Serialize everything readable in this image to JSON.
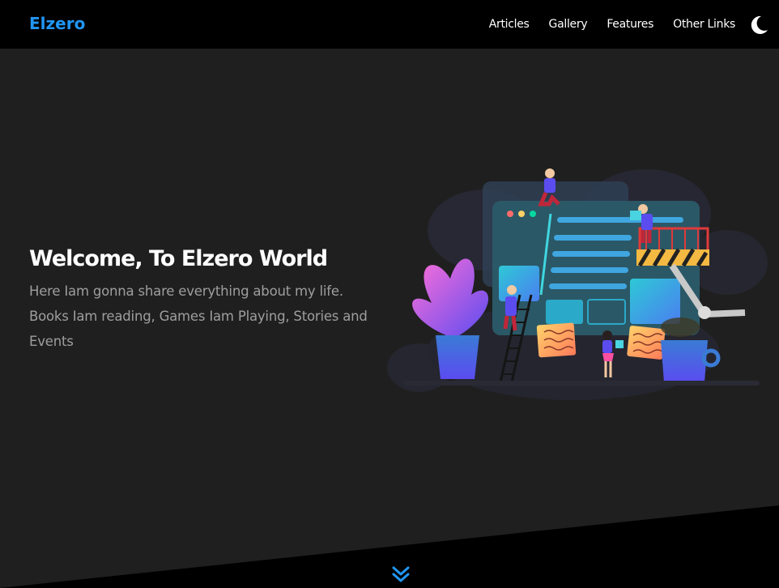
{
  "header": {
    "logo": "Elzero",
    "nav": [
      {
        "label": "Articles"
      },
      {
        "label": "Gallery"
      },
      {
        "label": "Features"
      },
      {
        "label": "Other Links"
      }
    ],
    "theme_toggle_icon": "moon-icon"
  },
  "hero": {
    "title": "Welcome, To Elzero World",
    "description": "Here Iam gonna share everything about my life. Books Iam reading, Games Iam Playing, Stories and Events",
    "illustration": "website-builders-illustration"
  },
  "scroll_icon": "double-chevron-down-icon",
  "colors": {
    "accent": "#2196f3",
    "background": "#1f1f1f",
    "header": "#000000",
    "text": "#ffffff",
    "muted_text": "#9e9e9e"
  }
}
